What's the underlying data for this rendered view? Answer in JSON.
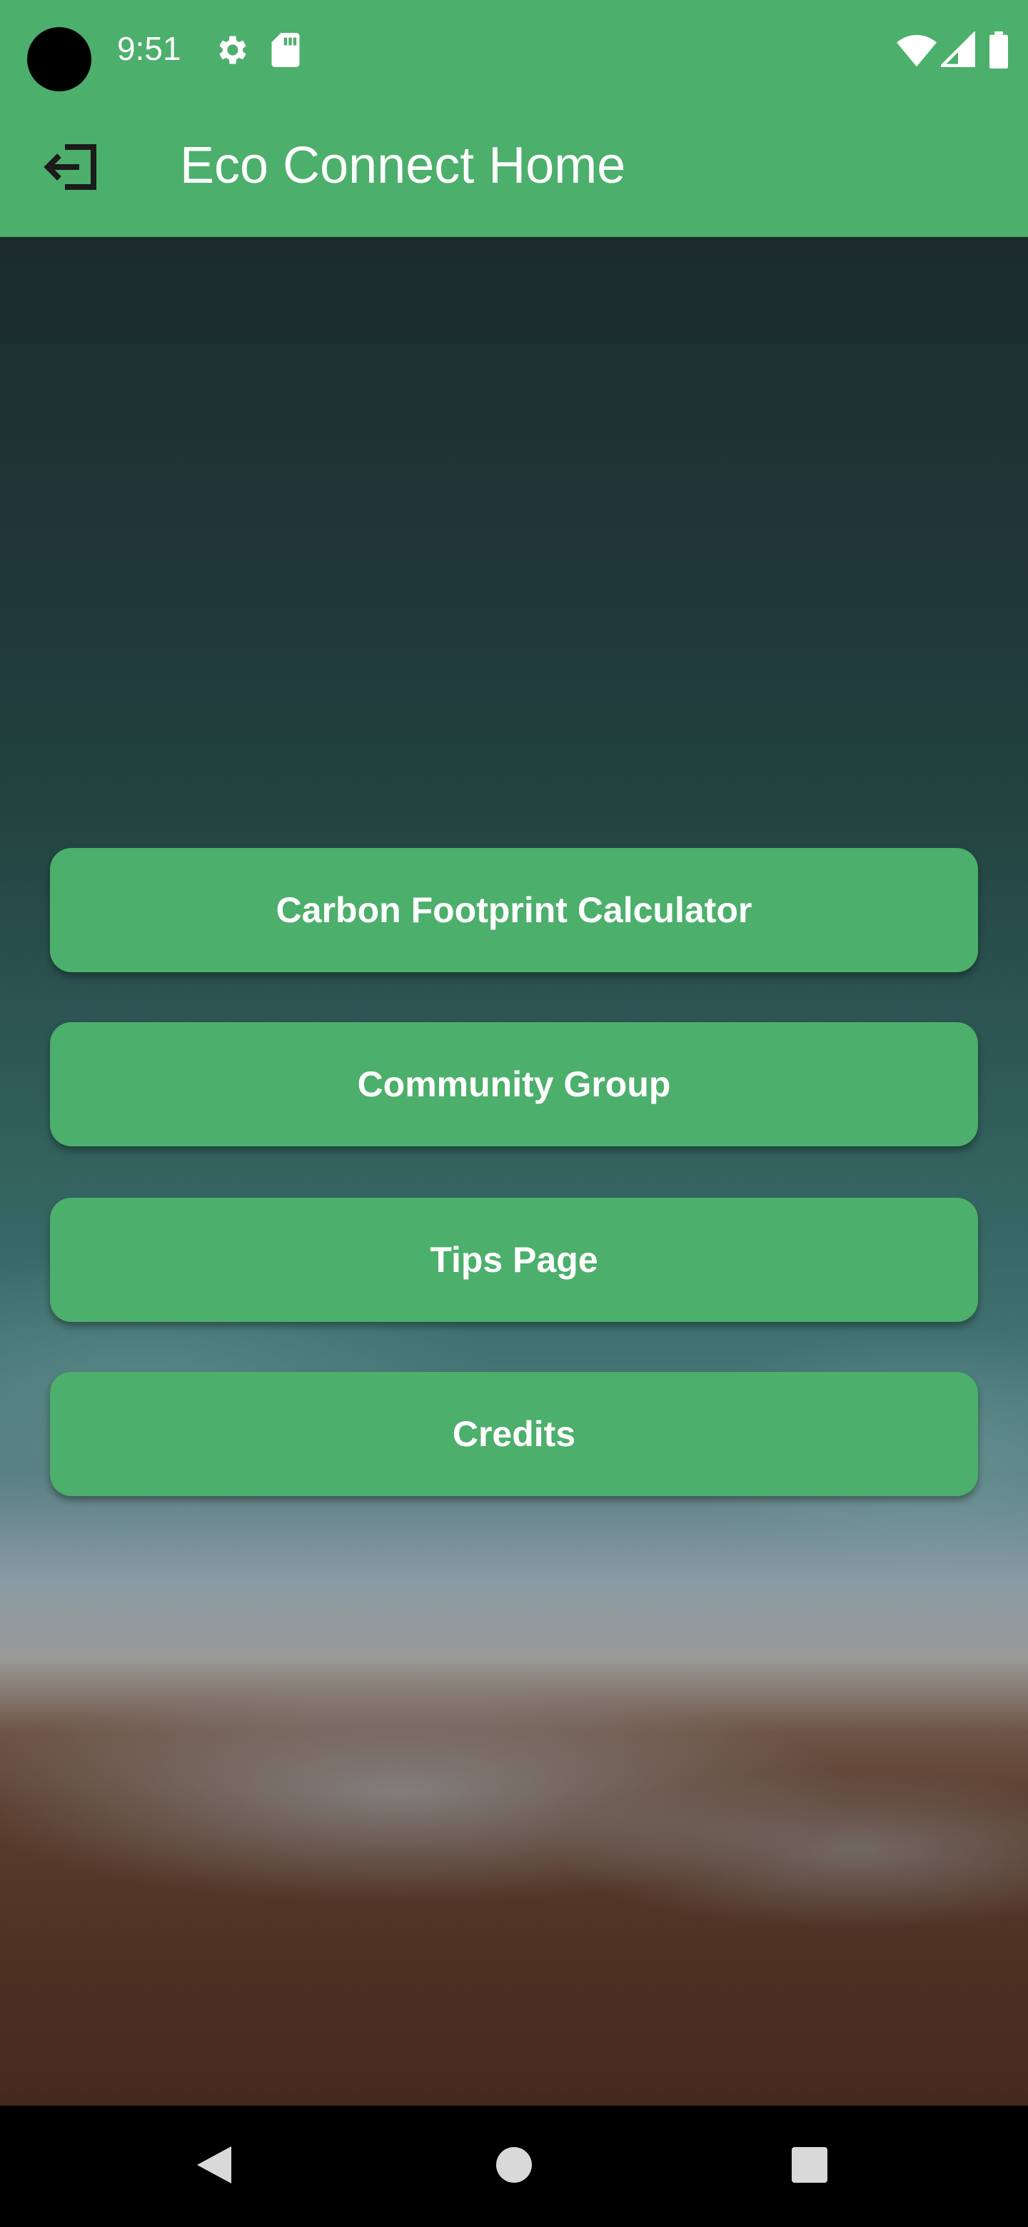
{
  "status_bar": {
    "time": "9:51",
    "icons": [
      "settings-icon",
      "sd-card-icon",
      "wifi-icon",
      "signal-icon",
      "battery-icon"
    ]
  },
  "app_bar": {
    "title": "Eco Connect Home",
    "back_icon": "logout-icon"
  },
  "menu": {
    "items": [
      {
        "label": "Carbon Footprint Calculator"
      },
      {
        "label": "Community Group"
      },
      {
        "label": "Tips Page"
      },
      {
        "label": "Credits"
      }
    ]
  },
  "nav_bar": {
    "icons": [
      "back-icon",
      "home-icon",
      "recents-icon"
    ]
  },
  "colors": {
    "primary": "#4caf6b",
    "on_primary": "#ffffff"
  }
}
